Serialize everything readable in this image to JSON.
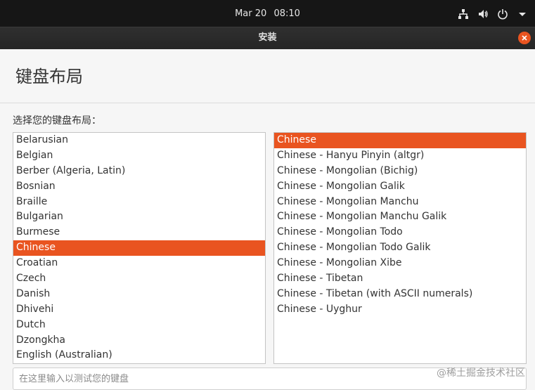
{
  "topbar": {
    "date": "Mar 20",
    "time": "08:10",
    "icons": [
      "network-icon",
      "volume-icon",
      "power-icon",
      "chevron-down-icon"
    ]
  },
  "window": {
    "title": "安装"
  },
  "page": {
    "title": "键盘布局",
    "prompt": "选择您的键盘布局："
  },
  "layouts": {
    "selected": "Chinese",
    "items": [
      "Belarusian",
      "Belgian",
      "Berber (Algeria, Latin)",
      "Bosnian",
      "Braille",
      "Bulgarian",
      "Burmese",
      "Chinese",
      "Croatian",
      "Czech",
      "Danish",
      "Dhivehi",
      "Dutch",
      "Dzongkha",
      "English (Australian)"
    ]
  },
  "variants": {
    "selected": "Chinese",
    "items": [
      "Chinese",
      "Chinese - Hanyu Pinyin (altgr)",
      "Chinese - Mongolian (Bichig)",
      "Chinese - Mongolian Galik",
      "Chinese - Mongolian Manchu",
      "Chinese - Mongolian Manchu Galik",
      "Chinese - Mongolian Todo",
      "Chinese - Mongolian Todo Galik",
      "Chinese - Mongolian Xibe",
      "Chinese - Tibetan",
      "Chinese - Tibetan (with ASCII numerals)",
      "Chinese - Uyghur"
    ]
  },
  "test_field": {
    "placeholder": "在这里输入以测试您的键盘",
    "value": ""
  },
  "watermark": "@稀土掘金技术社区",
  "colors": {
    "accent": "#e95420",
    "topbar": "#161616",
    "titlebar": "#2a2a2a"
  }
}
